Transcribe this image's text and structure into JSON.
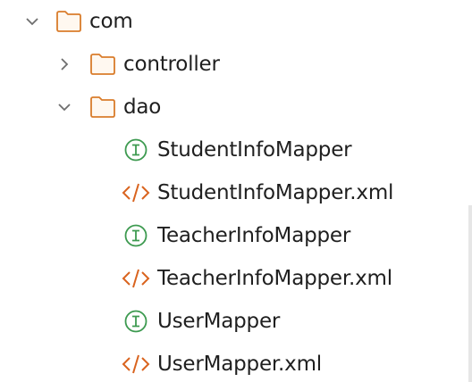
{
  "tree": {
    "root": {
      "label": "com",
      "expanded": true
    },
    "controller": {
      "label": "controller",
      "expanded": false
    },
    "dao": {
      "label": "dao",
      "expanded": true
    },
    "files": [
      {
        "label": "StudentInfoMapper",
        "kind": "interface",
        "icon": "interface-icon"
      },
      {
        "label": "StudentInfoMapper.xml",
        "kind": "xml",
        "icon": "xml-file-icon"
      },
      {
        "label": "TeacherInfoMapper",
        "kind": "interface",
        "icon": "interface-icon"
      },
      {
        "label": "TeacherInfoMapper.xml",
        "kind": "xml",
        "icon": "xml-file-icon"
      },
      {
        "label": "UserMapper",
        "kind": "interface",
        "icon": "interface-icon"
      },
      {
        "label": "UserMapper.xml",
        "kind": "xml",
        "icon": "xml-file-icon"
      }
    ]
  },
  "colors": {
    "folder_outline": "#d97c2b",
    "interface_green": "#3d9a50",
    "xml_orange": "#d9631e",
    "chevron": "#6e6e6e",
    "text": "#1f1f1f"
  }
}
